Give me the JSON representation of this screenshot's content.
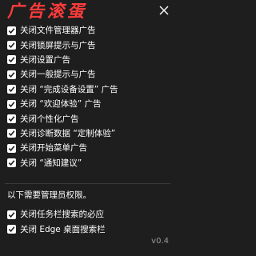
{
  "app": {
    "title": "广告滚蛋",
    "title_color": "#ff3b3b",
    "close_icon": "close-icon",
    "version": "v0.4"
  },
  "options": [
    {
      "label": "关闭文件管理器广告",
      "checked": true
    },
    {
      "label": "关闭锁屏提示与广告",
      "checked": true
    },
    {
      "label": "关闭设置广告",
      "checked": true
    },
    {
      "label": "关闭一般提示与广告",
      "checked": true
    },
    {
      "label": "关闭 “完成设备设置” 广告",
      "checked": true
    },
    {
      "label": "关闭 “欢迎体验” 广告",
      "checked": true
    },
    {
      "label": "关闭个性化广告",
      "checked": true
    },
    {
      "label": "关闭诊断数据 “定制体验”",
      "checked": true
    },
    {
      "label": "关闭开始菜单广告",
      "checked": true
    },
    {
      "label": "关闭 “通知建议”",
      "checked": true
    }
  ],
  "admin": {
    "note": "以下需要管理员权限。",
    "options": [
      {
        "label": "关闭任务栏搜索的必应",
        "checked": true
      },
      {
        "label": "关闭 Edge 桌面搜索栏",
        "checked": true
      }
    ]
  }
}
